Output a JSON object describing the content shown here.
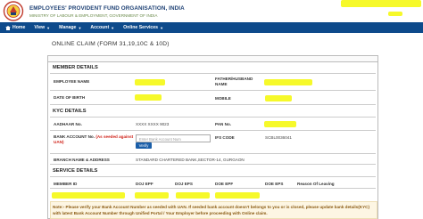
{
  "header": {
    "org_title": "EMPLOYEES' PROVIDENT FUND ORGANISATION, INDIA",
    "org_subtitle": "MINISTRY OF LABOUR & EMPLOYMENT, GOVERNMENT OF INDIA"
  },
  "nav": {
    "items": [
      {
        "label": "Home"
      },
      {
        "label": "View"
      },
      {
        "label": "Manage"
      },
      {
        "label": "Account"
      },
      {
        "label": "Online Services"
      }
    ]
  },
  "panel": {
    "title": "ONLINE CLAIM (FORM 31,19,10C & 10D)"
  },
  "member_details": {
    "heading": "MEMBER DETAILS",
    "employee_name_label": "EMPLOYEE NAME",
    "father_husband_label": "FATHER/HUSBAND NAME",
    "dob_label": "DATE OF BIRTH",
    "mobile_label": "MOBILE"
  },
  "kyc_details": {
    "heading": "KYC DETAILS",
    "aadhaar_label": "AADHAAR No.",
    "aadhaar_value": "XXXX XXXX 9023",
    "pan_label": "PAN No.",
    "bank_account_label": "BANK ACCOUNT No.",
    "bank_account_note": "(As seeded against UAN)",
    "bank_account_placeholder": "Enter Bank Account Num",
    "verify_label": "Verify",
    "ifsc_label": "IFS CODE",
    "ifsc_value": "SCBL0036041",
    "branch_label": "BRANCH NAME & ADDRESS",
    "branch_value": "STANDARD CHARTERED BANK,SECTOR-14, GURGAON"
  },
  "service_details": {
    "heading": "SERVICE DETAILS",
    "columns": [
      "MEMBER ID",
      "DOJ EPF",
      "DOJ EPS",
      "DOE EPF",
      "DOE EPS",
      "Reason Of Leaving"
    ]
  },
  "notice": {
    "text": "Note:- Please verify your Bank Account Number as seeded with UAN. If seeded bank account doesn't belongs to you or is closed, please update bank details(KYC) with latest Bank Account Number through Unified Portal / Your Employer before proceeding with Online claim."
  },
  "colors": {
    "nav_bg": "#0d4a8b",
    "highlight": "#f6f92a",
    "title_blue": "#1c3f73",
    "red_note": "#d0241b",
    "button_blue": "#1a5ea8"
  }
}
